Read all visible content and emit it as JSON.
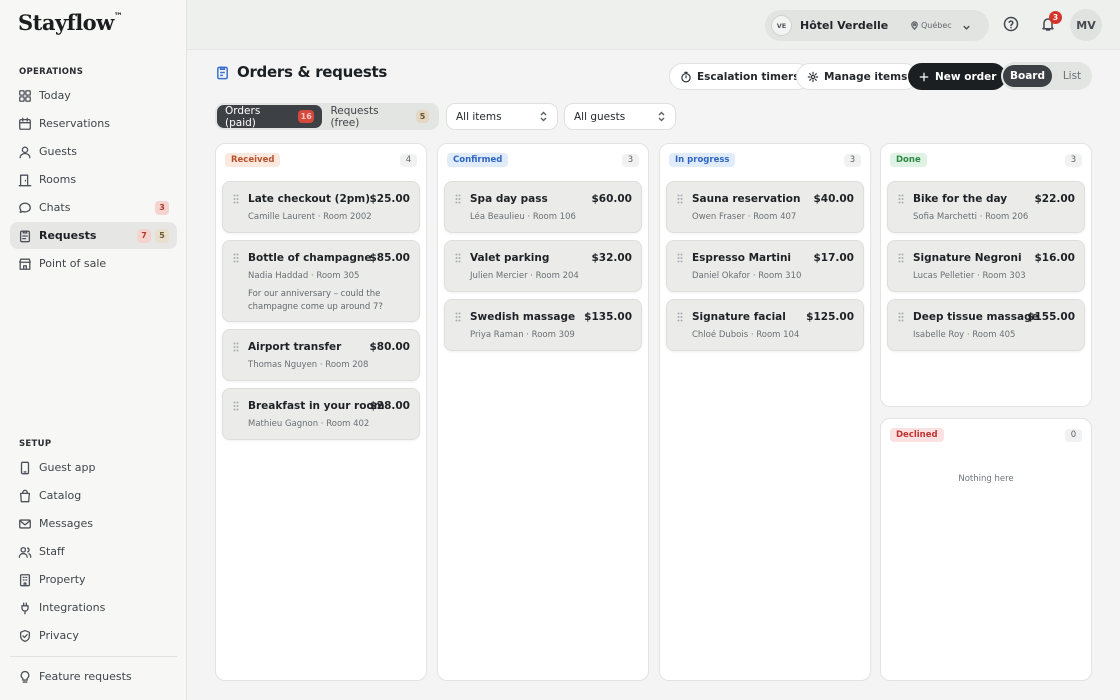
{
  "app": {
    "logo": "Stayflow",
    "logo_mark": "™"
  },
  "sidebar": {
    "operations_label": "OPERATIONS",
    "setup_label": "SETUP",
    "operations": [
      {
        "label": "Today",
        "icon": "grid-icon"
      },
      {
        "label": "Reservations",
        "icon": "calendar-icon"
      },
      {
        "label": "Guests",
        "icon": "user-icon"
      },
      {
        "label": "Rooms",
        "icon": "door-icon"
      },
      {
        "label": "Chats",
        "icon": "chat-icon",
        "badge": "3"
      },
      {
        "label": "Requests",
        "icon": "clipboard-icon",
        "badge_red": "7",
        "badge_tan": "5"
      },
      {
        "label": "Point of sale",
        "icon": "storefront-icon"
      }
    ],
    "setup": [
      {
        "label": "Guest app",
        "icon": "phone-icon"
      },
      {
        "label": "Catalog",
        "icon": "bag-icon"
      },
      {
        "label": "Messages",
        "icon": "mail-icon"
      },
      {
        "label": "Staff",
        "icon": "staff-icon"
      },
      {
        "label": "Property",
        "icon": "building-icon"
      },
      {
        "label": "Integrations",
        "icon": "integration-icon"
      },
      {
        "label": "Privacy",
        "icon": "shield-icon"
      }
    ],
    "footer": {
      "label": "Feature requests",
      "icon": "bulb-icon"
    }
  },
  "topbar": {
    "hotel_initials": "VE",
    "hotel_name": "Hôtel Verdelle",
    "hotel_region": "Québec",
    "notifications_count": "3",
    "user_initials": "MV"
  },
  "page": {
    "title": "Orders & requests",
    "escalation_label": "Escalation timers",
    "manage_label": "Manage items",
    "new_order_label": "New order",
    "view_board": "Board",
    "view_list": "List"
  },
  "filters": {
    "orders_label": "Orders (paid)",
    "orders_count": "16",
    "requests_label": "Requests (free)",
    "requests_count": "5",
    "items_select": "All items",
    "guests_select": "All guests"
  },
  "board": {
    "empty_text": "Nothing here",
    "columns": [
      {
        "name": "Received",
        "count": "4",
        "tag_bg": "#fbe8df",
        "tag_color": "#b8522d",
        "cards": [
          {
            "title": "Late checkout (2pm)",
            "price": "$25.00",
            "meta": "Camille Laurent · Room 2002",
            "note": ""
          },
          {
            "title": "Bottle of champagne",
            "price": "$85.00",
            "meta": "Nadia Haddad · Room 305",
            "note": "For our anniversary – could the champagne come up around 7?"
          },
          {
            "title": "Airport transfer",
            "price": "$80.00",
            "meta": "Thomas Nguyen · Room 208",
            "note": ""
          },
          {
            "title": "Breakfast in your room",
            "price": "$28.00",
            "meta": "Mathieu Gagnon · Room 402",
            "note": ""
          }
        ]
      },
      {
        "name": "Confirmed",
        "count": "3",
        "tag_bg": "#e1ecfb",
        "tag_color": "#2f66c3",
        "cards": [
          {
            "title": "Spa day pass",
            "price": "$60.00",
            "meta": "Léa Beaulieu · Room 106",
            "note": ""
          },
          {
            "title": "Valet parking",
            "price": "$32.00",
            "meta": "Julien Mercier · Room 204",
            "note": ""
          },
          {
            "title": "Swedish massage",
            "price": "$135.00",
            "meta": "Priya Raman · Room 309",
            "note": ""
          }
        ]
      },
      {
        "name": "In progress",
        "count": "3",
        "tag_bg": "#e1ecfb",
        "tag_color": "#2f66c3",
        "cards": [
          {
            "title": "Sauna reservation",
            "price": "$40.00",
            "meta": "Owen Fraser · Room 407",
            "note": ""
          },
          {
            "title": "Espresso Martini",
            "price": "$17.00",
            "meta": "Daniel Okafor · Room 310",
            "note": ""
          },
          {
            "title": "Signature facial",
            "price": "$125.00",
            "meta": "Chloé Dubois · Room 104",
            "note": ""
          }
        ]
      },
      {
        "name": "Done",
        "count": "3",
        "tag_bg": "#e0f2e3",
        "tag_color": "#2e8a45",
        "cards": [
          {
            "title": "Bike for the day",
            "price": "$22.00",
            "meta": "Sofia Marchetti · Room 206",
            "note": ""
          },
          {
            "title": "Signature Negroni",
            "price": "$16.00",
            "meta": "Lucas Pelletier · Room 303",
            "note": ""
          },
          {
            "title": "Deep tissue massage",
            "price": "$155.00",
            "meta": "Isabelle Roy · Room 405",
            "note": ""
          }
        ]
      },
      {
        "name": "Declined",
        "count": "0",
        "tag_bg": "#fbe1e1",
        "tag_color": "#c03434",
        "cards": []
      }
    ]
  }
}
